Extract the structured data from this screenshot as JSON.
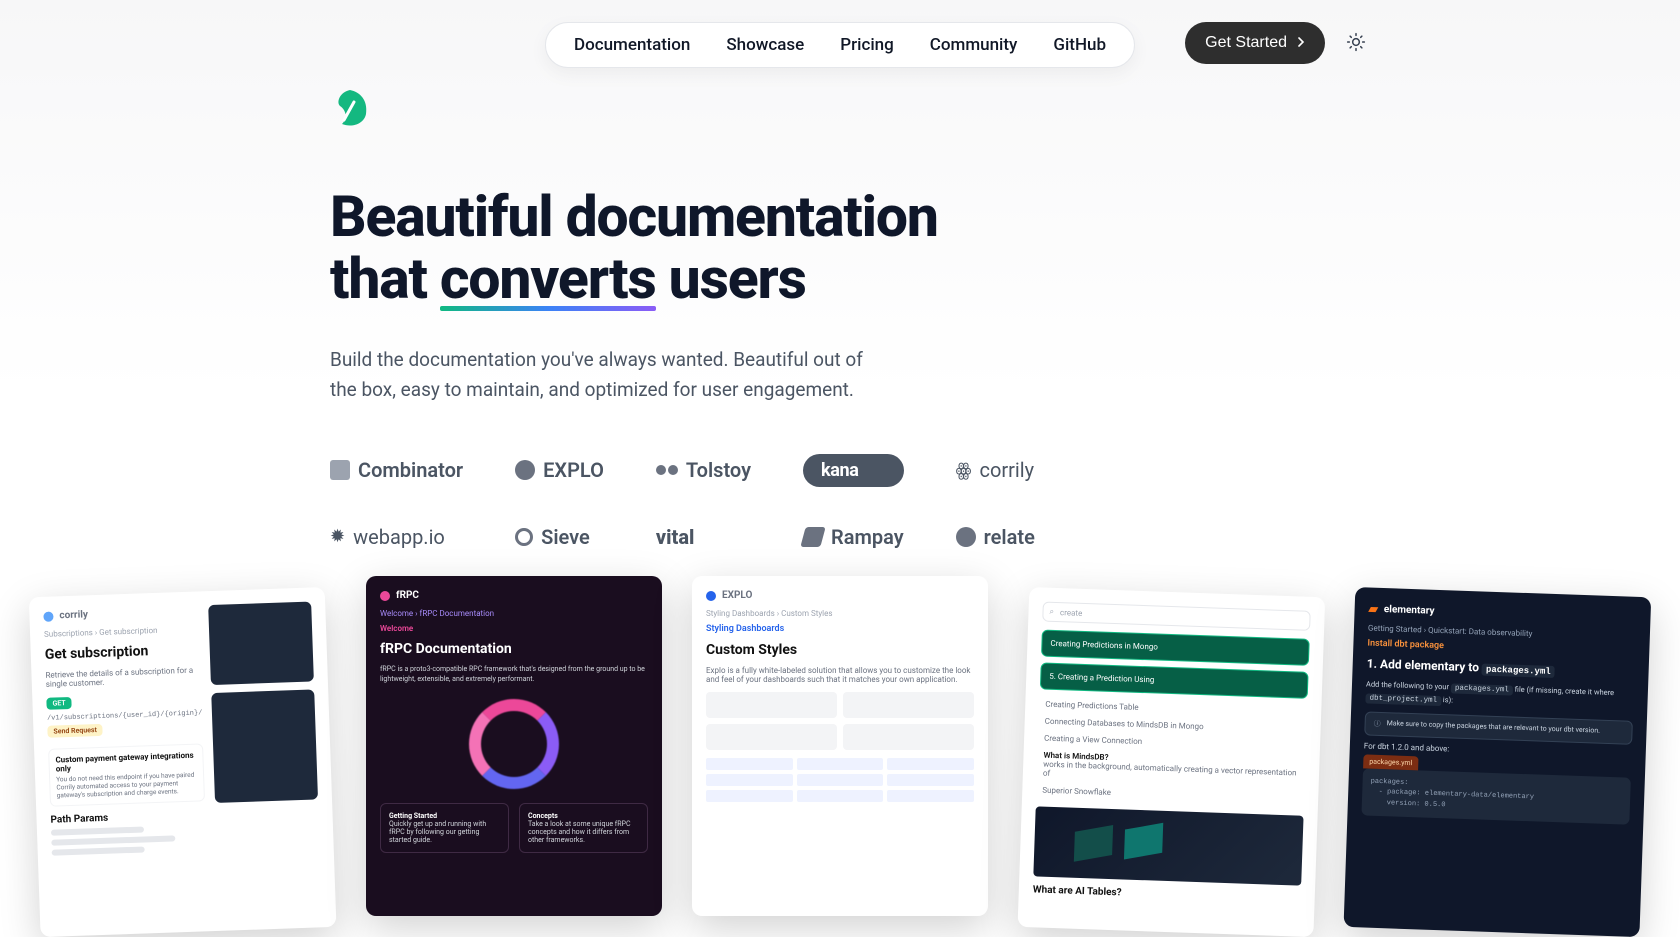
{
  "nav": {
    "items": [
      "Documentation",
      "Showcase",
      "Pricing",
      "Community",
      "GitHub"
    ],
    "cta": "Get Started"
  },
  "hero": {
    "line1": "Beautiful documentation",
    "line2_a": "that ",
    "line2_u": "converts",
    "line2_b": " users",
    "subtext": "Build the documentation you've always wanted. Beautiful out of the box, easy to maintain, and optimized for user engagement."
  },
  "brands_row1": [
    "Combinator",
    "EXPLO",
    "Tolstoy",
    "kana",
    "corrily"
  ],
  "brands_row2": [
    "webapp.io",
    "Sieve",
    "vital",
    "Rampay",
    "relate"
  ],
  "shots": {
    "corrily": {
      "brand": "corrily",
      "crumbs": "Subscriptions  ›  Get subscription",
      "title": "Get subscription",
      "blurb": "Retrieve the details of a subscription for a single customer.",
      "method": "GET",
      "path": "/v1/subscriptions/{user_id}/{origin}/",
      "send": "Send Request",
      "note_t": "Custom payment gateway integrations only",
      "note_b": "You do not need this endpoint if you have paired Corrily automated access to your payment gateway's subscription and charge events.",
      "section": "Path Params"
    },
    "frpc": {
      "brand": "fRPC",
      "crumbs": "Welcome  ›  fRPC Documentation",
      "title": "fRPC Documentation",
      "blurb": "fRPC is a proto3-compatible RPC framework that's designed from the ground up to be lightweight, extensible, and extremely performant.",
      "card1_t": "Getting Started",
      "card1_b": "Quickly get up and running with fRPC by following our getting started guide.",
      "card2_t": "Concepts",
      "card2_b": "Take a look at some unique fRPC concepts and how it differs from other frameworks."
    },
    "explo": {
      "brand": "EXPLO",
      "crumbs": "Styling Dashboards  ›  Custom Styles",
      "sub": "Styling Dashboards",
      "title": "Custom Styles",
      "blurb": "Explo is a fully white-labeled solution that allows you to customize the look and feel of your dashboards such that it matches your own application."
    },
    "mindsdb": {
      "search": "create",
      "i1": "Creating Predictions in Mongo",
      "i2": "5. Creating a Prediction Using",
      "i3": "Creating Predictions Table",
      "i4": "Connecting Databases to MindsDB in Mongo",
      "i5": "Creating a View Connection",
      "i6_t": "What is MindsDB?",
      "i6_b": "works in the background, automatically creating a vector representation of",
      "i7": "Superior Snowflake",
      "footer": "What are AI Tables?"
    },
    "elementary": {
      "brand": "elementary",
      "crumbs": "Getting Started  ›  Quickstart: Data observability",
      "h1": "Install dbt package",
      "step": "1. Add elementary to",
      "file": "packages.yml",
      "p1a": "Add the following to your ",
      "p1b": " file (if missing, create it where ",
      "p1c": " is):",
      "pkgfile": "packages.yml",
      "projfile": "dbt_project.yml",
      "alert": "Make sure to copy the packages that are relevant to your dbt version.",
      "p2": "For dbt 1.2.0 and above:",
      "code_fn": "packages.yml",
      "code": "packages:\n  - package: elementary-data/elementary\n    version: 0.5.0"
    }
  }
}
